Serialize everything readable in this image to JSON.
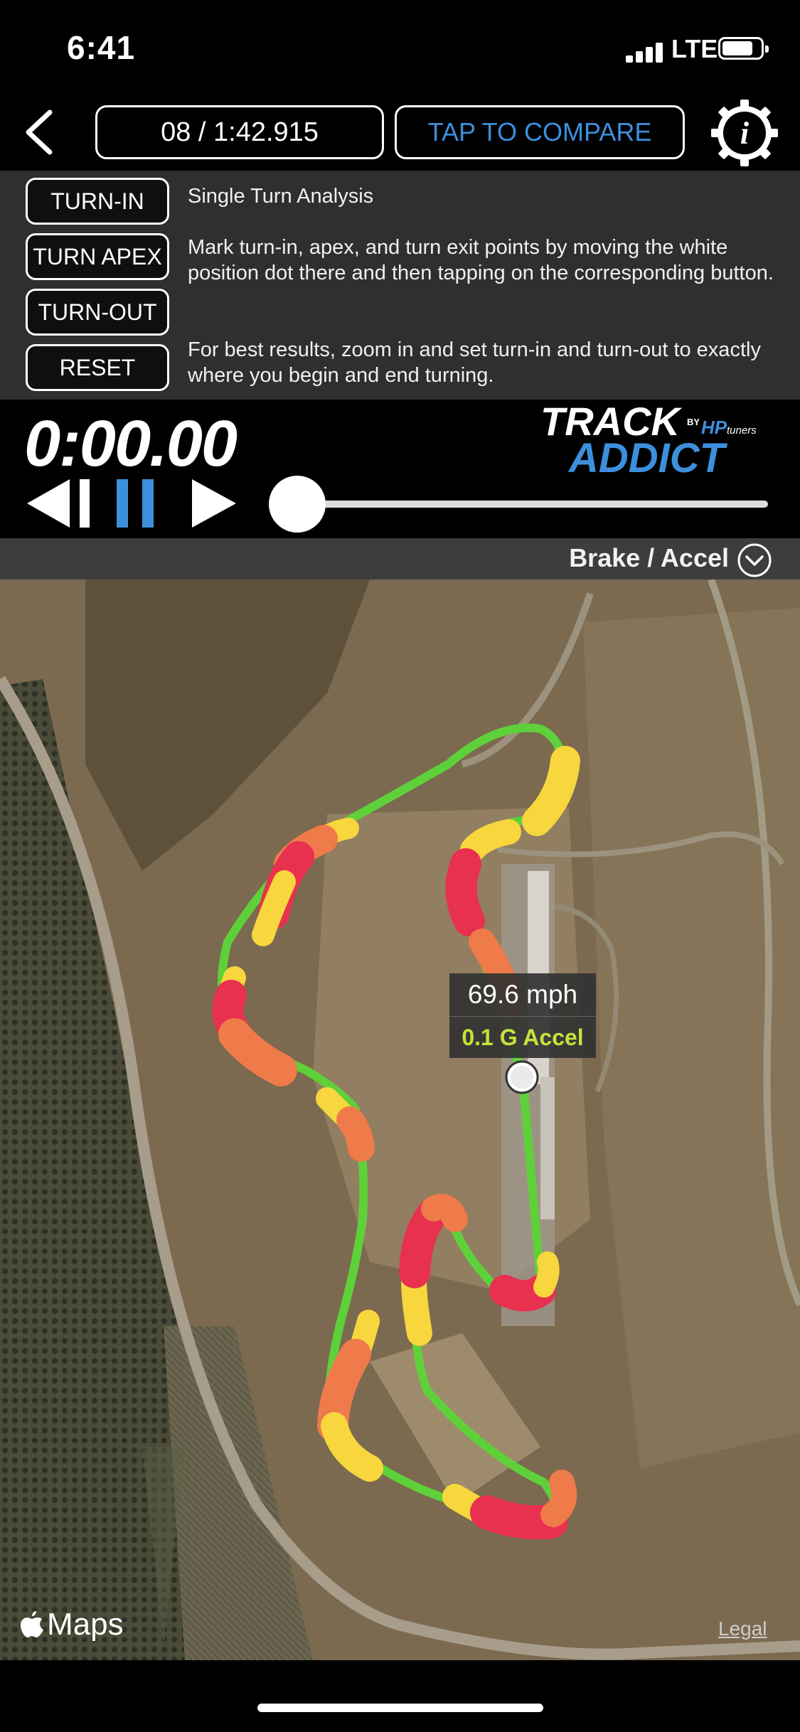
{
  "status_bar": {
    "time": "6:41",
    "network": "LTE",
    "battery_level": 0.72
  },
  "nav": {
    "lap_time": "08 / 1:42.915",
    "compare_label": "TAP TO COMPARE"
  },
  "turn_panel": {
    "buttons": [
      "TURN-IN",
      "TURN APEX",
      "TURN-OUT",
      "RESET"
    ],
    "title": "Single Turn Analysis",
    "instructions": "Mark turn-in, apex, and turn exit points by moving the white position dot there and then tapping on the corresponding button.",
    "tip": "For best results, zoom in and set turn-in and turn-out to exactly where you begin and end turning."
  },
  "playback": {
    "timer": "0:00.00",
    "progress": 0.0
  },
  "logo": {
    "track": "TRACK",
    "by": "BY",
    "hp": "HP",
    "tuners": "tuners",
    "addict": "ADDICT"
  },
  "mode": {
    "label": "Brake / Accel"
  },
  "map": {
    "speed": "69.6 mph",
    "accel": "0.1 G Accel",
    "brand": "Maps",
    "legal": "Legal"
  },
  "colors": {
    "accent": "#3d8fdc",
    "accel_green": "#5ed13a",
    "coast_yellow": "#f7d63e",
    "brake_orange": "#ef7a4a",
    "brake_red": "#e8304f",
    "accel_text": "#c6e23b"
  }
}
